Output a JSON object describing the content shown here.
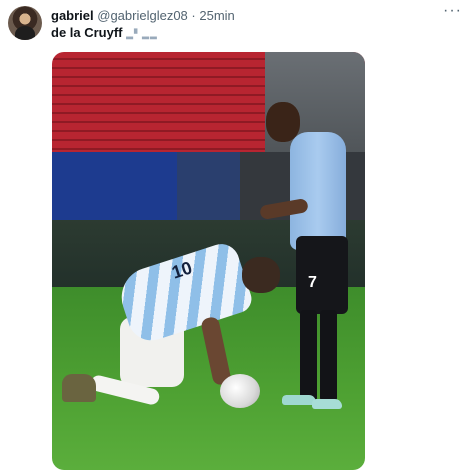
{
  "tweet": {
    "display_name": "gabriel",
    "handle": "@gabrielglez08",
    "separator": "·",
    "time": "25min",
    "more_icon": "···",
    "text": "de la Cruyff",
    "emoji_text": "▂▘▂▂"
  },
  "media": {
    "shirt_number_standing": "7",
    "shirt_number_kneeling": "10",
    "colors": {
      "pitch": "#4fa233",
      "stands": "#b82531",
      "sky_blue_shirt": "#a9cbef",
      "shorts_dark": "#15161a"
    }
  }
}
